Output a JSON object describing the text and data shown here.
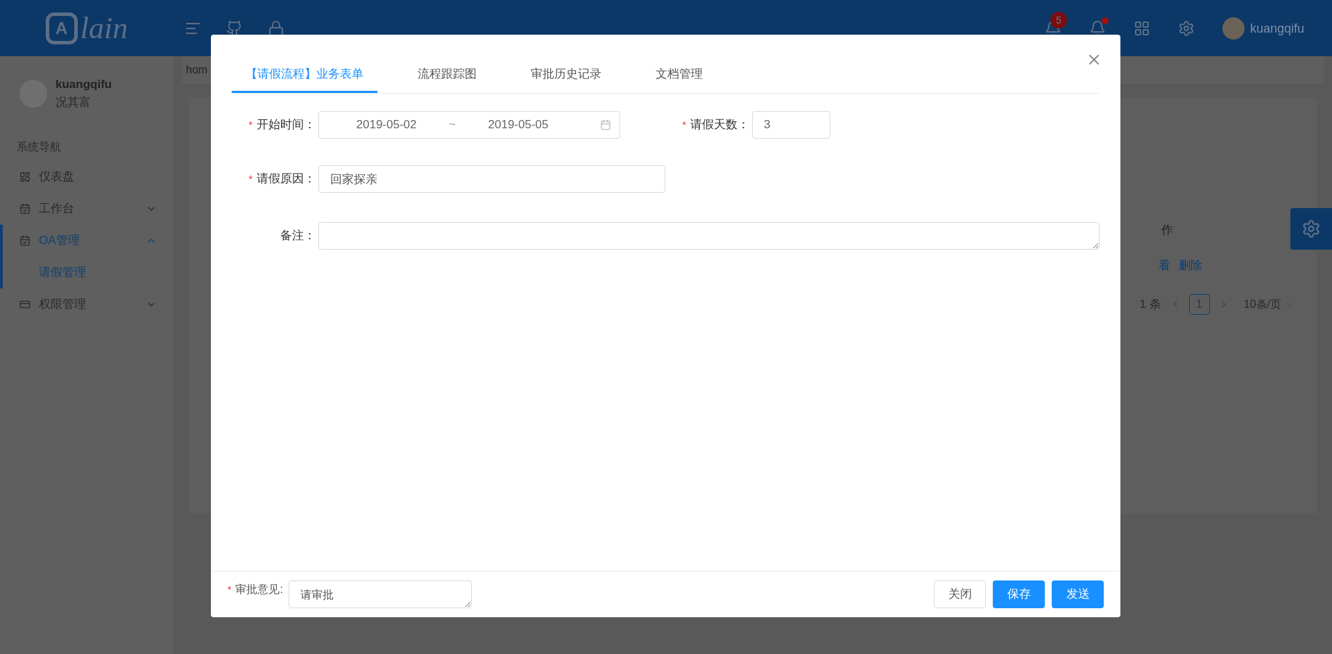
{
  "header": {
    "logo_mark": "A",
    "logo_text": "lain",
    "notice_count": "5",
    "unread_dot": true,
    "user": "kuangqifu"
  },
  "breadcrumb": "hom",
  "sidebar": {
    "user_name": "kuangqifu",
    "user_title": "况其富",
    "group": "系统导航",
    "items": [
      {
        "label": "仪表盘",
        "kind": "grid",
        "selected": false
      },
      {
        "label": "工作台",
        "kind": "calendar",
        "selected": false,
        "expanded": false
      },
      {
        "label": "OA管理",
        "kind": "calendar",
        "selected": true,
        "expanded": true,
        "children": [
          {
            "label": "请假管理",
            "selected": true
          }
        ]
      },
      {
        "label": "权限管理",
        "kind": "card",
        "selected": false,
        "expanded": false
      }
    ]
  },
  "background_table": {
    "column_heading": "作",
    "actions": [
      "看",
      "删除"
    ],
    "total": "1 条",
    "page": "1",
    "page_size": "10条/页"
  },
  "dialog": {
    "tabs": [
      {
        "label": "【请假流程】业务表单",
        "selected": true
      },
      {
        "label": "流程跟踪图",
        "selected": false
      },
      {
        "label": "审批历史记录",
        "selected": false
      },
      {
        "label": "文档管理",
        "selected": false
      }
    ],
    "start_time": {
      "label": "开始时间：",
      "required_mark": "*",
      "from": "2019-05-02",
      "separator": "~",
      "to": "2019-05-05"
    },
    "days": {
      "label": "请假天数：",
      "required_mark": "*",
      "value": "3"
    },
    "reason": {
      "label": "请假原因：",
      "required_mark": "*",
      "value": "回家探亲"
    },
    "remark": {
      "label": "备注："
    },
    "opinion": {
      "label": "审批意见:",
      "required_mark": "*",
      "value": "请审批"
    },
    "buttons": [
      {
        "label": "关闭",
        "kind": "default"
      },
      {
        "label": "保存",
        "kind": "primary"
      },
      {
        "label": "发送",
        "kind": "primary"
      }
    ]
  }
}
